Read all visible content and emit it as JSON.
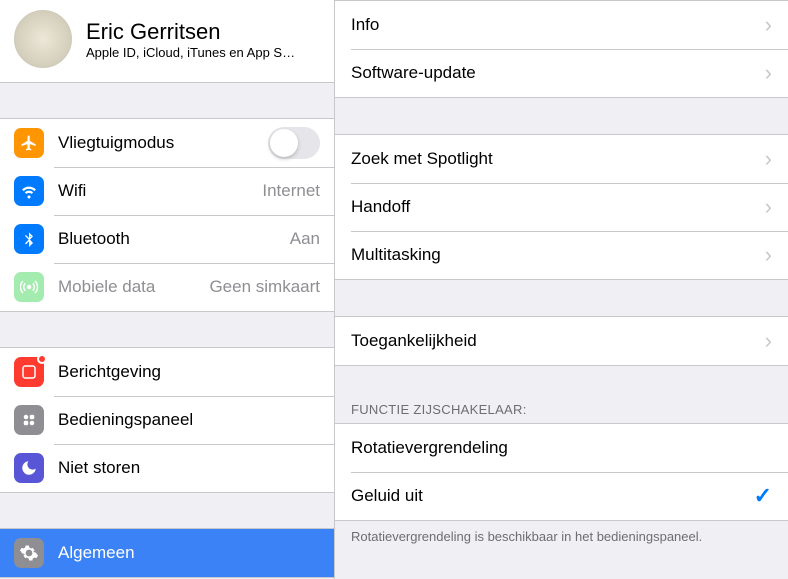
{
  "profile": {
    "name": "Eric Gerritsen",
    "subtitle": "Apple ID, iCloud, iTunes en App S…"
  },
  "sidebar": {
    "items": [
      {
        "label": "Vliegtuigmodus",
        "value": ""
      },
      {
        "label": "Wifi",
        "value": "Internet"
      },
      {
        "label": "Bluetooth",
        "value": "Aan"
      },
      {
        "label": "Mobiele data",
        "value": "Geen simkaart"
      },
      {
        "label": "Berichtgeving",
        "value": ""
      },
      {
        "label": "Bedieningspaneel",
        "value": ""
      },
      {
        "label": "Niet storen",
        "value": ""
      },
      {
        "label": "Algemeen",
        "value": ""
      }
    ]
  },
  "detail": {
    "group1": [
      {
        "label": "Info"
      },
      {
        "label": "Software-update"
      }
    ],
    "group2": [
      {
        "label": "Zoek met Spotlight"
      },
      {
        "label": "Handoff"
      },
      {
        "label": "Multitasking"
      }
    ],
    "group3": [
      {
        "label": "Toegankelijkheid"
      }
    ],
    "sideSwitch": {
      "header": "FUNCTIE ZIJSCHAKELAAR:",
      "options": [
        {
          "label": "Rotatievergrendeling"
        },
        {
          "label": "Geluid uit"
        }
      ],
      "footer": "Rotatievergrendeling is beschikbaar in het bedieningspaneel."
    }
  }
}
